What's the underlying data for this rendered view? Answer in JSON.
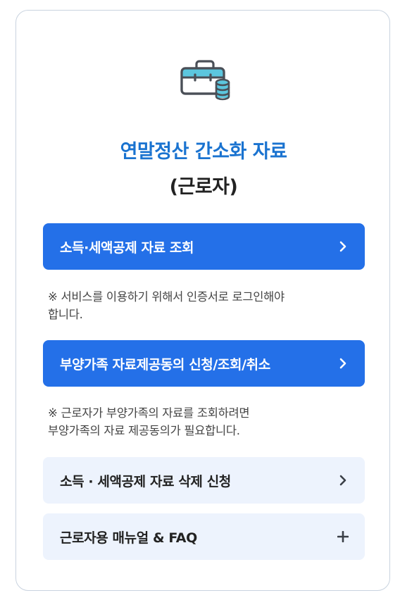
{
  "title": {
    "line1": "연말정산 간소화 자료",
    "line2": "(근로자)"
  },
  "buttons": {
    "income_deduction_view": "소득·세액공제 자료 조회",
    "dependent_consent": "부양가족 자료제공동의 신청/조회/취소",
    "deletion_request": "소득 · 세액공제 자료 삭제 신청",
    "manual_faq": "근로자용 매뉴얼 & FAQ"
  },
  "notes": {
    "login_line1": "※ 서비스를 이용하기 위해서 인증서로 로그인해야",
    "login_line2": "합니다.",
    "consent_line1": "※ 근로자가 부양가족의 자료를 조회하려면",
    "consent_line2": "부양가족의 자료 제공동의가 필요합니다."
  },
  "icons": {
    "logo": "briefcase-coins-icon",
    "arrow": "chevron-right-icon",
    "expand": "plus-icon"
  },
  "colors": {
    "primary": "#2470e8",
    "title_blue": "#1a73d0",
    "light_button": "#edf3fd",
    "border": "#c9d3df"
  }
}
